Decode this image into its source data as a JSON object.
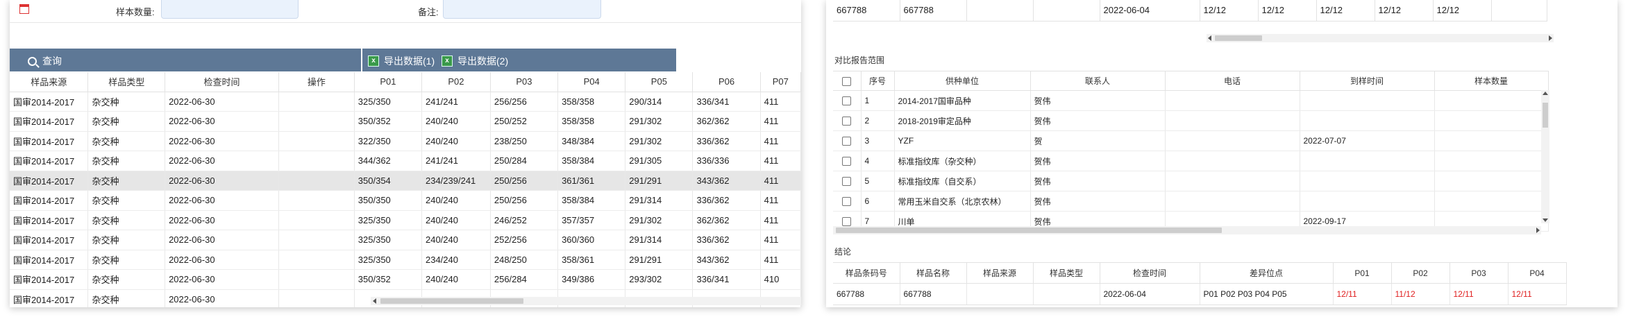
{
  "left": {
    "form": {
      "sample_qty_label": "样本数量:",
      "remark_label": "备注:"
    },
    "toolbar": {
      "query": "查询",
      "export1": "导出数据(1)",
      "export2": "导出数据(2)"
    },
    "table": {
      "columns": [
        "样品来源",
        "样品类型",
        "检查时间",
        "操作",
        "P01",
        "P02",
        "P03",
        "P04",
        "P05",
        "P06",
        "P07"
      ],
      "rows": [
        [
          "国审2014-2017",
          "杂交种",
          "2022-06-30",
          "",
          "325/350",
          "241/241",
          "256/256",
          "358/358",
          "290/314",
          "336/341",
          "411"
        ],
        [
          "国审2014-2017",
          "杂交种",
          "2022-06-30",
          "",
          "350/352",
          "240/240",
          "250/252",
          "358/358",
          "291/302",
          "362/362",
          "411"
        ],
        [
          "国审2014-2017",
          "杂交种",
          "2022-06-30",
          "",
          "322/350",
          "240/240",
          "238/250",
          "348/384",
          "291/302",
          "336/362",
          "411"
        ],
        [
          "国审2014-2017",
          "杂交种",
          "2022-06-30",
          "",
          "344/362",
          "241/241",
          "250/284",
          "358/384",
          "291/305",
          "336/336",
          "411"
        ],
        [
          "国审2014-2017",
          "杂交种",
          "2022-06-30",
          "",
          "350/354",
          "234/239/241",
          "250/256",
          "361/361",
          "291/291",
          "343/362",
          "411"
        ],
        [
          "国审2014-2017",
          "杂交种",
          "2022-06-30",
          "",
          "350/350",
          "240/240",
          "250/256",
          "358/384",
          "291/314",
          "336/362",
          "411"
        ],
        [
          "国审2014-2017",
          "杂交种",
          "2022-06-30",
          "",
          "325/350",
          "240/240",
          "246/252",
          "357/357",
          "291/302",
          "362/362",
          "411"
        ],
        [
          "国审2014-2017",
          "杂交种",
          "2022-06-30",
          "",
          "325/350",
          "240/240",
          "252/256",
          "360/360",
          "291/314",
          "336/362",
          "411"
        ],
        [
          "国审2014-2017",
          "杂交种",
          "2022-06-30",
          "",
          "325/350",
          "234/240",
          "248/250",
          "358/361",
          "291/291",
          "343/362",
          "411"
        ],
        [
          "国审2014-2017",
          "杂交种",
          "2022-06-30",
          "",
          "350/352",
          "240/240",
          "256/284",
          "349/386",
          "293/302",
          "336/341",
          "410"
        ],
        [
          "国审2014-2017",
          "杂交种",
          "2022-06-30",
          "",
          "",
          "",
          "",
          "",
          "",
          "",
          ""
        ]
      ],
      "selected_row": 4
    }
  },
  "right": {
    "top_row": [
      "667788",
      "667788",
      "",
      "",
      "2022-06-04",
      "12/12",
      "12/12",
      "12/12",
      "12/12",
      "12/12",
      ""
    ],
    "compare_label": "对比报告范围",
    "compare": {
      "columns": [
        "",
        "序号",
        "供种单位",
        "联系人",
        "电话",
        "到样时间",
        "样本数量"
      ],
      "rows": [
        [
          "",
          "1",
          "2014-2017国审品种",
          "贺伟",
          "",
          "",
          ""
        ],
        [
          "",
          "2",
          "2018-2019审定品种",
          "贺伟",
          "",
          "",
          ""
        ],
        [
          "",
          "3",
          "YZF",
          "贺",
          "",
          "2022-07-07",
          ""
        ],
        [
          "",
          "4",
          "标准指纹库（杂交种）",
          "贺伟",
          "",
          "",
          ""
        ],
        [
          "",
          "5",
          "标准指纹库（自交系）",
          "贺伟",
          "",
          "",
          ""
        ],
        [
          "",
          "6",
          "常用玉米自交系（北京农林）",
          "贺伟",
          "",
          "",
          ""
        ],
        [
          "",
          "7",
          "川单",
          "贺伟",
          "",
          "2022-09-17",
          ""
        ]
      ]
    },
    "conclusion_label": "结论",
    "conclusion": {
      "columns": [
        "样品条码号",
        "样品名称",
        "样品来源",
        "样品类型",
        "检查时间",
        "差异位点",
        "P01",
        "P02",
        "P03",
        "P04"
      ],
      "row": [
        "667788",
        "667788",
        "",
        "",
        "2022-06-04",
        "P01 P02 P03 P04 P05",
        "12/11",
        "11/12",
        "12/11",
        "12/11"
      ]
    }
  }
}
